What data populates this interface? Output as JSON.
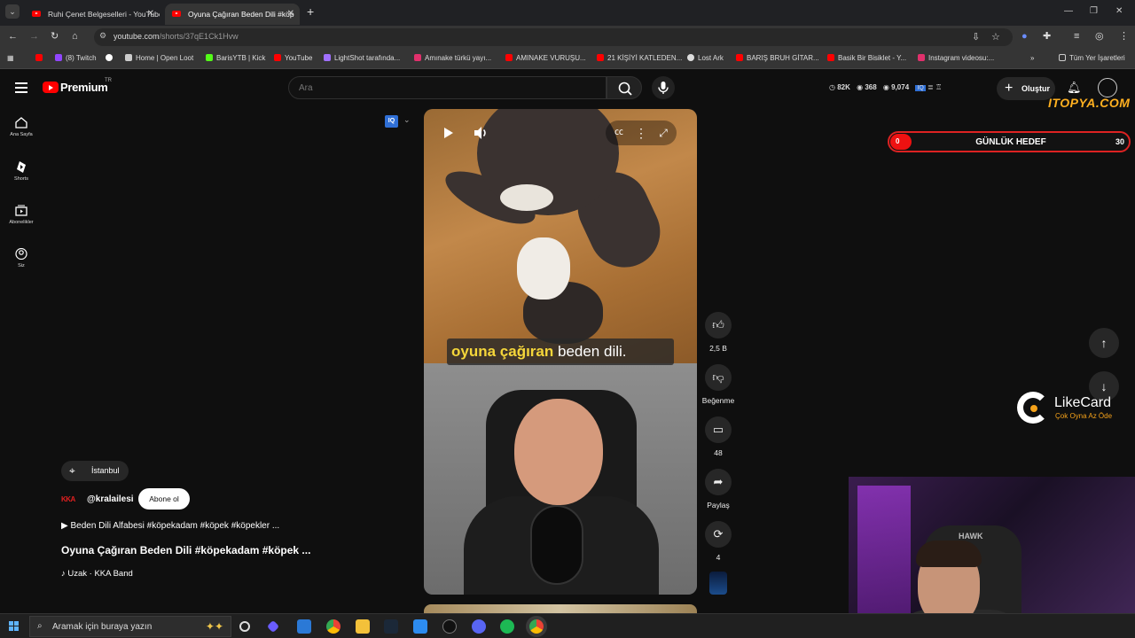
{
  "browser": {
    "tabs": [
      {
        "title": "Ruhi Çenet Belgeselleri - YouTube",
        "active": false
      },
      {
        "title": "Oyuna Çağıran Beden Dili #köp",
        "active": true
      }
    ],
    "url_host": "youtube.com",
    "url_path": "/shorts/37qE1Ck1Hvw",
    "bookmarks": [
      {
        "label": "(8) Twitch",
        "color": "#9146ff"
      },
      {
        "label": "",
        "color": "#ffffff"
      },
      {
        "label": "Home | Open Loot",
        "color": "#cccccc"
      },
      {
        "label": "BarisYTB | Kick",
        "color": "#53fc18"
      },
      {
        "label": "YouTube",
        "color": "#ff0000"
      },
      {
        "label": "LightShot tarafında...",
        "color": "#a070ff"
      },
      {
        "label": "Amınake türkü yayı...",
        "color": "#e1306c"
      },
      {
        "label": "AMINAKE VURUŞU...",
        "color": "#ff0000"
      },
      {
        "label": "21 KİŞİYİ KATLEDEN...",
        "color": "#ff0000"
      },
      {
        "label": "Lost Ark",
        "color": "#dddddd"
      },
      {
        "label": "BARIŞ BRUH GİTAR...",
        "color": "#ff0000"
      },
      {
        "label": "Basik Bir Bisiklet - Y...",
        "color": "#ff0000"
      },
      {
        "label": "Instagram videosu:...",
        "color": "#e1306c"
      }
    ],
    "bookmarks_all": "Tüm Yer İşaretleri"
  },
  "youtube": {
    "brand": "Premium",
    "country": "TR",
    "search_placeholder": "Ara",
    "stats": {
      "views": "82K",
      "watching": "368",
      "third": "9,074"
    },
    "create_label": "Oluştur",
    "sponsor_overlay": "ITOPYA.COM",
    "nav": [
      {
        "label": "Ana Sayfa",
        "icon": "home-icon"
      },
      {
        "label": "Shorts",
        "icon": "shorts-icon"
      },
      {
        "label": "Abonelikler",
        "icon": "subscriptions-icon"
      },
      {
        "label": "Siz",
        "icon": "account-icon"
      }
    ],
    "iq_badge": "IQ",
    "video": {
      "caption_highlight": "oyuna çağıran",
      "caption_rest": " beden dili."
    },
    "actions": {
      "likes": "2,5 B",
      "dislike_label": "Beğenme",
      "comments": "48",
      "share_label": "Paylaş",
      "remix": "4"
    },
    "info": {
      "location": "İstanbul",
      "channel_logo_text": "KKA",
      "channel": "@kralailesi",
      "subscribe": "Abone ol",
      "playlist": "▶ Beden Dili Alfabesi #köpekadam #köpek #köpekler ...",
      "title": "Oyuna Çağıran Beden Dili #köpekadam #köpek ...",
      "music": "♪ Uzak · KKA Band"
    }
  },
  "stream_overlays": {
    "goal": {
      "current": "0",
      "label": "GÜNLÜK HEDEF",
      "target": "30",
      "progress": 0
    },
    "likecard": {
      "name": "LikeCard",
      "tagline": "Çok Oyna Az Öde"
    },
    "webcam_chair_text": "HAWK"
  },
  "taskbar": {
    "search_placeholder": "Aramak için buraya yazın"
  },
  "colors": {
    "accent_red": "#ff0000",
    "background": "#0f0f0f",
    "caption_highlight": "#f5d63a"
  }
}
